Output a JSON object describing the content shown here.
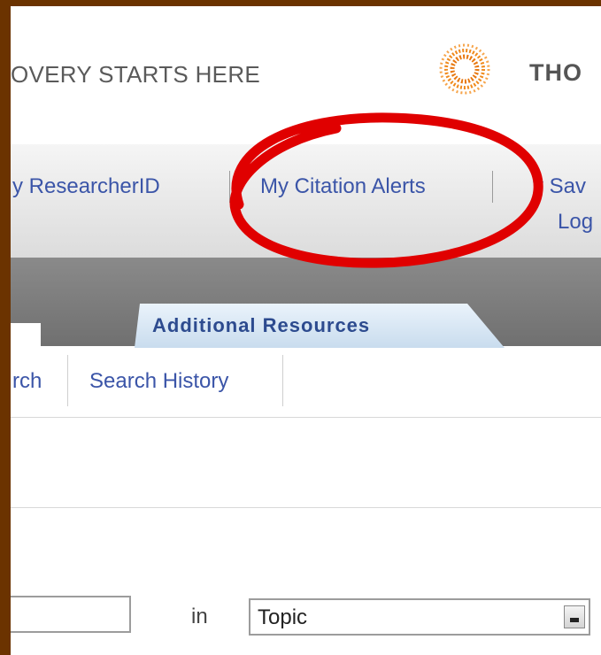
{
  "header": {
    "tagline": "OVERY STARTS HERE",
    "brand": "THO",
    "logo_icon": "thomson-reuters-logo-icon"
  },
  "topnav": {
    "items": [
      {
        "label": "y ResearcherID"
      },
      {
        "label": "My Citation Alerts"
      },
      {
        "label": "y Sav"
      }
    ],
    "logout": "Log"
  },
  "tabs": {
    "additional_resources": "Additional Resources"
  },
  "subnav": {
    "search": "rch",
    "history": "Search History"
  },
  "search": {
    "in_label": "in",
    "field_value": "",
    "select_value": "Topic",
    "dropdown_icon": "dropdown-arrow-icon"
  },
  "annotation": {
    "color": "#e00000",
    "shape": "ellipse-highlight"
  }
}
